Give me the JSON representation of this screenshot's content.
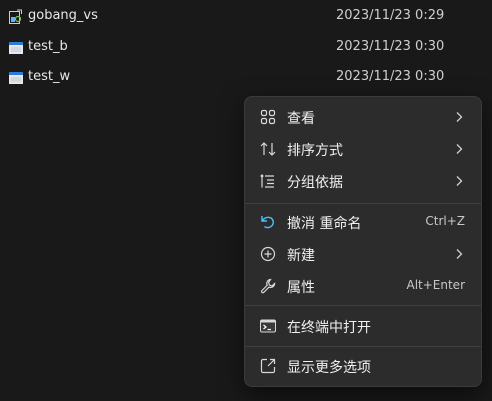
{
  "files": [
    {
      "name": "gobang_vs",
      "date": "2023/11/23 0:29",
      "icon": "executable-icon"
    },
    {
      "name": "test_b",
      "date": "2023/11/23 0:30",
      "icon": "window-app-icon"
    },
    {
      "name": "test_w",
      "date": "2023/11/23 0:30",
      "icon": "window-app-icon"
    }
  ],
  "context_menu": {
    "items": [
      {
        "label": "查看",
        "icon": "grid-view-icon",
        "submenu": true
      },
      {
        "label": "排序方式",
        "icon": "sort-icon",
        "submenu": true
      },
      {
        "label": "分组依据",
        "icon": "group-by-icon",
        "submenu": true
      },
      {
        "label": "撤消 重命名",
        "icon": "undo-icon",
        "shortcut": "Ctrl+Z"
      },
      {
        "label": "新建",
        "icon": "new-icon",
        "submenu": true
      },
      {
        "label": "属性",
        "icon": "wrench-icon",
        "shortcut": "Alt+Enter"
      },
      {
        "label": "在终端中打开",
        "icon": "terminal-icon"
      },
      {
        "label": "显示更多选项",
        "icon": "more-options-icon"
      }
    ]
  },
  "colors": {
    "background": "#191919",
    "menu": "#2c2c2c",
    "accent": "#4cc2ff"
  }
}
